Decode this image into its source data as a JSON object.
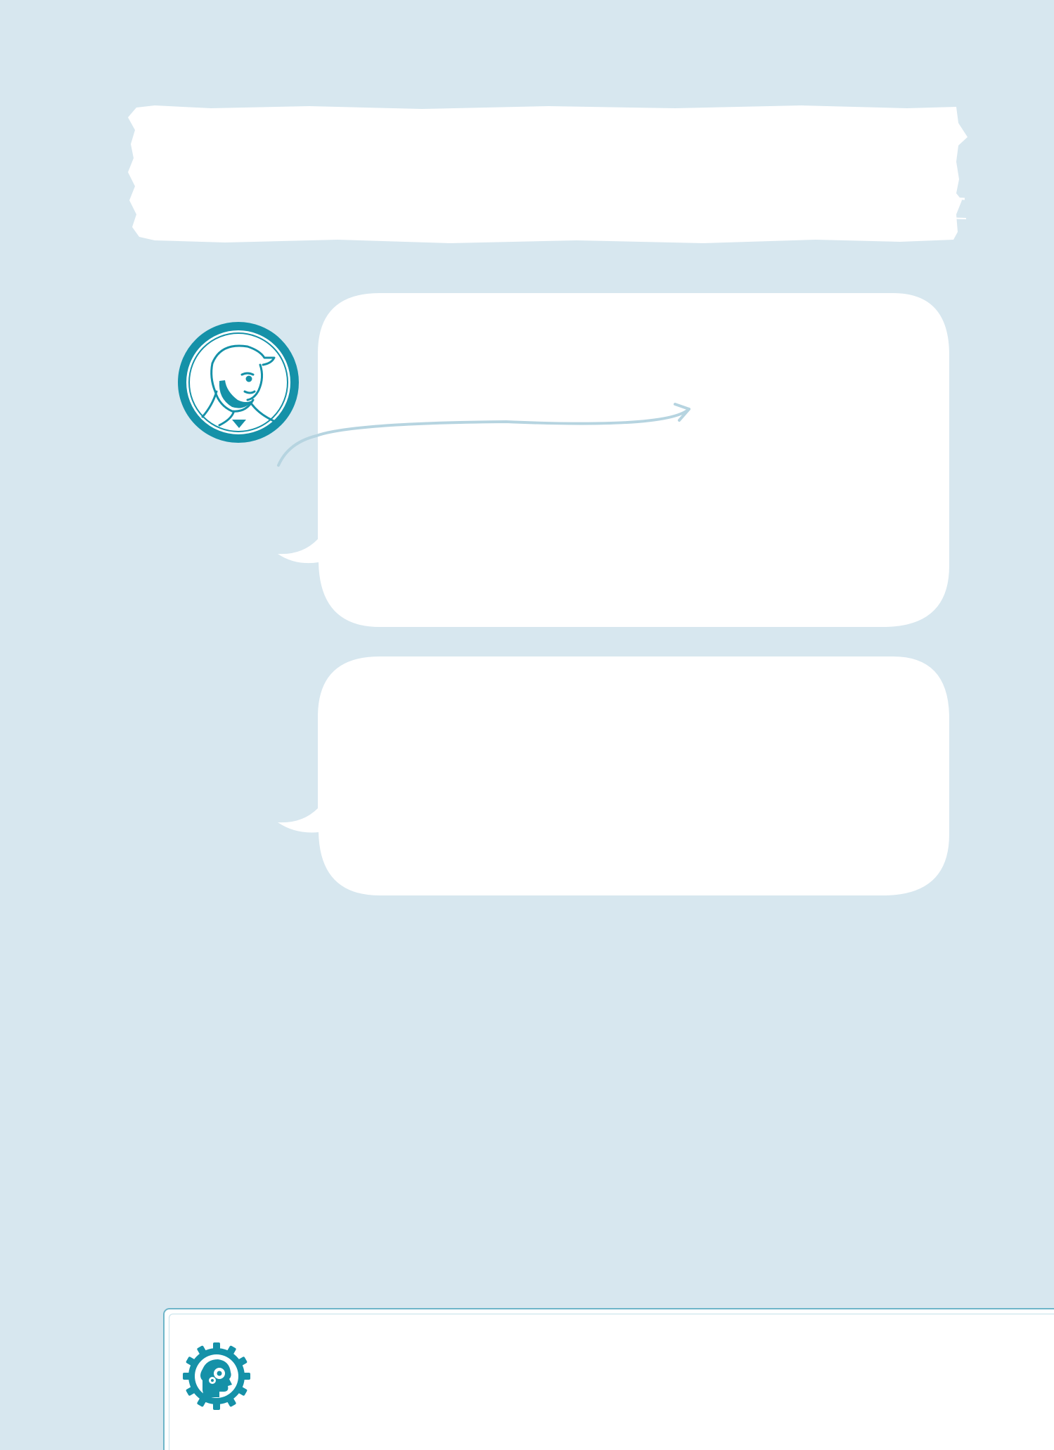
{
  "colors": {
    "background": "#d7e7ef",
    "accent": "#1591a8",
    "bubble": "#ffffff",
    "arrow": "#b6d4e0",
    "panel_border": "#6eb5c9"
  },
  "icons": {
    "avatar": "bearded-man-with-cap-icon",
    "tip": "head-with-gears-icon"
  }
}
